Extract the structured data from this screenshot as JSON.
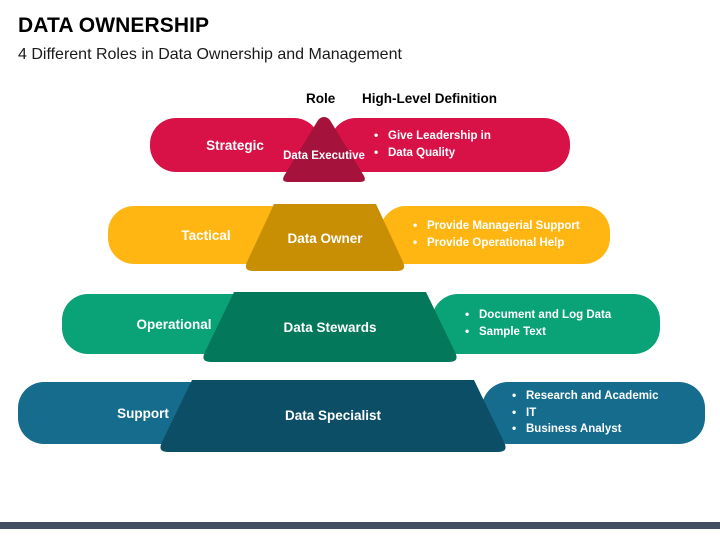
{
  "header": {
    "title": "DATA OWNERSHIP",
    "subtitle": "4 Different Roles in Data Ownership and Management"
  },
  "columns": {
    "role": "Role",
    "definition": "High-Level Definition"
  },
  "colors": {
    "strategic_light": "#D81247",
    "strategic_dark": "#A5123C",
    "tactical_light": "#FFB613",
    "tactical_dark": "#C98F04",
    "operational_light": "#09A377",
    "operational_dark": "#04785A",
    "support_light": "#156C8C",
    "support_dark": "#0D4E67",
    "footer_bar": "#434F63",
    "text_light": "#FFFFFF",
    "title_text": "#000000",
    "background": "#FFFFFF"
  },
  "rows": [
    {
      "id": "strategic",
      "category": "Strategic",
      "role": "Data Executive",
      "definitions": [
        "Give Leadership in",
        "Data Quality"
      ]
    },
    {
      "id": "tactical",
      "category": "Tactical",
      "role": "Data Owner",
      "definitions": [
        "Provide Managerial Support",
        "Provide Operational Help"
      ]
    },
    {
      "id": "operational",
      "category": "Operational",
      "role": "Data Stewards",
      "definitions": [
        "Document and Log Data",
        "Sample Text"
      ]
    },
    {
      "id": "support",
      "category": "Support",
      "role": "Data Specialist",
      "definitions": [
        "Research and Academic",
        "IT",
        "Business Analyst"
      ]
    }
  ]
}
